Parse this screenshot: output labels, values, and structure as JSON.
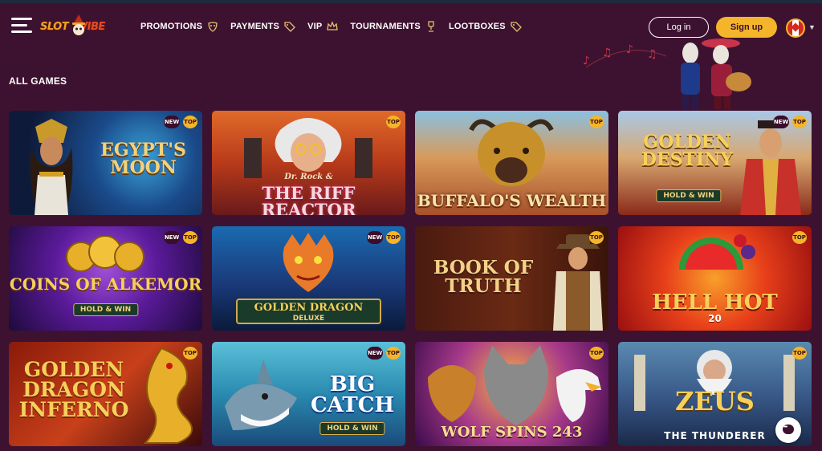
{
  "nav": {
    "items": [
      {
        "label": "PROMOTIONS",
        "icon": "mask-icon"
      },
      {
        "label": "PAYMENTS",
        "icon": "tag-icon"
      },
      {
        "label": "VIP",
        "icon": "crown-icon"
      },
      {
        "label": "TOURNAMENTS",
        "icon": "trophy-icon"
      },
      {
        "label": "LOOTBOXES",
        "icon": "tag-icon"
      }
    ]
  },
  "auth": {
    "login_label": "Log in",
    "signup_label": "Sign up"
  },
  "logo": {
    "text_a": "SLOT",
    "text_b": "VIBE"
  },
  "section": {
    "title": "ALL GAMES"
  },
  "games": [
    {
      "title": "EGYPT'S MOON",
      "badges": [
        "NEW",
        "TOP"
      ]
    },
    {
      "title_small": "Dr. Rock &",
      "title": "THE RIFF REACTOR",
      "badges": [
        "TOP"
      ]
    },
    {
      "title": "BUFFALO'S WEALTH",
      "badges": [
        "TOP"
      ]
    },
    {
      "title": "GOLDEN DESTINY",
      "sub": "HOLD & WIN",
      "badges": [
        "NEW",
        "TOP"
      ]
    },
    {
      "title": "COINS OF ALKEMOR",
      "sub": "HOLD & WIN",
      "badges": [
        "NEW",
        "TOP"
      ]
    },
    {
      "title": "GOLDEN DRAGON",
      "sub": "DELUXE",
      "badges": [
        "NEW",
        "TOP"
      ]
    },
    {
      "title": "BOOK OF TRUTH",
      "badges": [
        "TOP"
      ]
    },
    {
      "title": "HELL HOT",
      "sub": "20",
      "badges": [
        "TOP"
      ]
    },
    {
      "title": "GOLDEN DRAGON INFERNO",
      "badges": [
        "TOP"
      ]
    },
    {
      "title": "BIG CATCH",
      "sub": "HOLD & WIN",
      "badges": [
        "NEW",
        "TOP"
      ]
    },
    {
      "title": "WOLF SPINS 243",
      "badges": [
        "TOP"
      ]
    },
    {
      "title": "ZEUS",
      "sub": "THE THUNDERER",
      "badges": [
        "TOP"
      ]
    }
  ],
  "badge_labels": {
    "new": "NEW",
    "top": "TOP"
  },
  "colors": {
    "background": "#3d1230",
    "accent": "#f5b52a"
  }
}
